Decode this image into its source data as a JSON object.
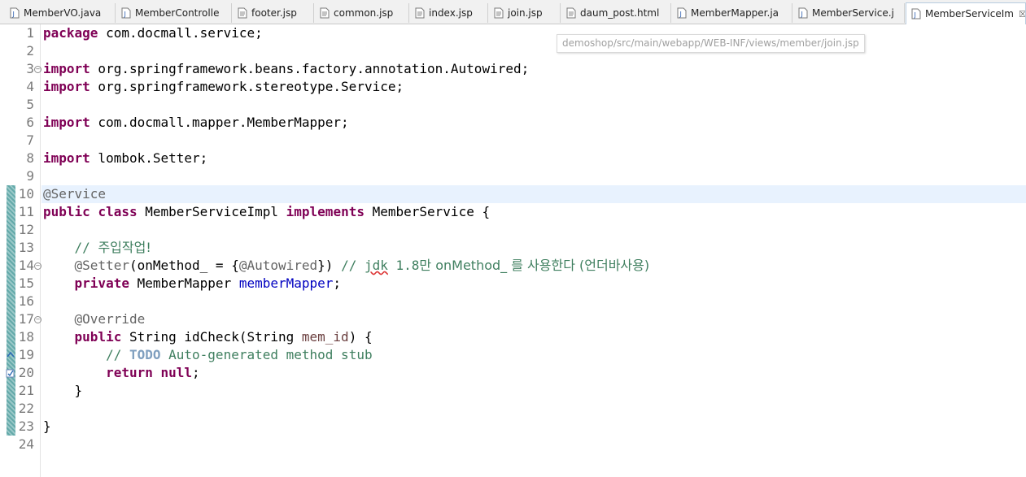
{
  "tabs": [
    {
      "label": "MemberVO.java",
      "icon": "java-file-icon"
    },
    {
      "label": "MemberControlle",
      "icon": "java-file-icon"
    },
    {
      "label": "footer.jsp",
      "icon": "jsp-file-icon"
    },
    {
      "label": "common.jsp",
      "icon": "jsp-file-icon"
    },
    {
      "label": "index.jsp",
      "icon": "jsp-file-icon"
    },
    {
      "label": "join.jsp",
      "icon": "jsp-file-icon"
    },
    {
      "label": "daum_post.html",
      "icon": "html-file-icon"
    },
    {
      "label": "MemberMapper.ja",
      "icon": "java-file-icon"
    },
    {
      "label": "MemberService.j",
      "icon": "java-file-icon"
    },
    {
      "label": "MemberServiceIm",
      "icon": "java-file-icon",
      "active": true
    }
  ],
  "active_tab_close": "☒",
  "tooltip": "demoshop/src/main/webapp/WEB-INF/views/member/join.jsp",
  "line_numbers": [
    "1",
    "2",
    "3",
    "4",
    "5",
    "6",
    "7",
    "8",
    "9",
    "10",
    "11",
    "12",
    "13",
    "14",
    "15",
    "16",
    "17",
    "18",
    "19",
    "20",
    "21",
    "22",
    "23",
    "24"
  ],
  "code": {
    "l1": {
      "kw": "package",
      "rest": " com.docmall.service;"
    },
    "l3": {
      "kw": "import",
      "rest": " org.springframework.beans.factory.annotation.Autowired;"
    },
    "l4": {
      "kw": "import",
      "rest": " org.springframework.stereotype.Service;"
    },
    "l6": {
      "kw": "import",
      "rest": " com.docmall.mapper.MemberMapper;"
    },
    "l8": {
      "kw": "import",
      "rest": " lombok.Setter;"
    },
    "l10": {
      "ann": "@Service"
    },
    "l11": {
      "kw1": "public",
      "kw2": "class",
      "name": " MemberServiceImpl ",
      "kw3": "implements",
      "rest": " MemberService {"
    },
    "l13": {
      "indent": "    ",
      "comment_a": "// ",
      "comment_ko": "주입작업!"
    },
    "l14": {
      "indent": "    ",
      "ann": "@Setter",
      "mid1": "(onMethod_ = {",
      "ann2": "@Autowired",
      "mid2": "}) ",
      "c1": "// ",
      "c2": "jdk",
      "c3": " 1.8",
      "c4": "만 onMethod_ 를 사용한다 (언더바사용)"
    },
    "l15": {
      "indent": "    ",
      "kw": "private",
      "type": " MemberMapper ",
      "field": "memberMapper",
      "end": ";"
    },
    "l17": {
      "indent": "    ",
      "ann": "@Override"
    },
    "l18": {
      "indent": "    ",
      "kw": "public",
      "mid": " String idCheck(String ",
      "param": "mem_id",
      "end": ") {"
    },
    "l19": {
      "indent": "        ",
      "c1": "// ",
      "todo": "TODO",
      "c2": " Auto-generated method stub"
    },
    "l20": {
      "indent": "        ",
      "kw1": "return",
      "sp": " ",
      "kw2": "null",
      "end": ";"
    },
    "l21": {
      "text": "    }"
    },
    "l23": {
      "text": "}"
    }
  },
  "colors": {
    "keyword": "#7f0055",
    "annotation": "#646464",
    "comment": "#3f7f5f",
    "todo": "#7f9fbf",
    "field": "#0000c0",
    "current_line": "#e8f2fe"
  }
}
